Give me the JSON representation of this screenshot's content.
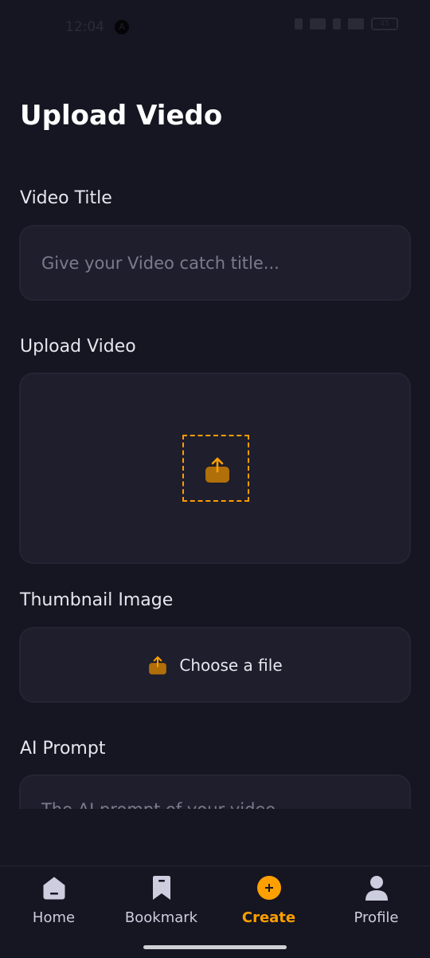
{
  "status_bar": {
    "time": "12:04",
    "battery": "45"
  },
  "page": {
    "title": "Upload Viedo"
  },
  "form": {
    "video_title_label": "Video Title",
    "video_title_placeholder": "Give your Video catch title...",
    "video_title_value": "",
    "upload_video_label": "Upload Video",
    "thumbnail_label": "Thumbnail Image",
    "choose_file_text": "Choose a file",
    "ai_prompt_label": "AI Prompt",
    "ai_prompt_placeholder": "The AI prompt of your video..."
  },
  "tabs": [
    {
      "label": "Home",
      "icon": "home-icon",
      "active": false
    },
    {
      "label": "Bookmark",
      "icon": "bookmark-icon",
      "active": false
    },
    {
      "label": "Create",
      "icon": "plus-circle-icon",
      "active": true
    },
    {
      "label": "Profile",
      "icon": "profile-icon",
      "active": false
    }
  ],
  "colors": {
    "background": "#161622",
    "field": "#1e1e2d",
    "accent": "#ff9c01"
  }
}
